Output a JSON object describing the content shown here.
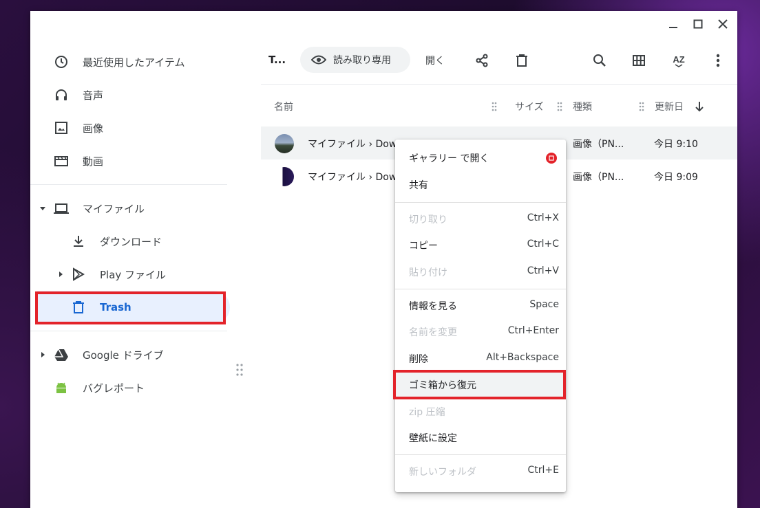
{
  "sidebar": {
    "recent": "最近使用したアイテム",
    "audio": "音声",
    "images": "画像",
    "videos": "動画",
    "my_files": "マイファイル",
    "downloads": "ダウンロード",
    "play_files": "Play ファイル",
    "trash": "Trash",
    "google_drive": "Google ドライブ",
    "bug_report": "バグレポート"
  },
  "toolbar": {
    "title": "T...",
    "readonly": "読み取り専用",
    "open": "開く",
    "sort_label": "AZ"
  },
  "list": {
    "columns": {
      "name": "名前",
      "size": "サイズ",
      "type": "種類",
      "modified": "更新日"
    },
    "rows": [
      {
        "name": "マイファイル › Dow",
        "type": "画像（PN...",
        "modified": "今日 9:10"
      },
      {
        "name": "マイファイル › Dow",
        "type": "画像（PN...",
        "modified": "今日 9:09"
      }
    ]
  },
  "menu": {
    "gallery": "ギャラリー で開く",
    "share": "共有",
    "cut": "切り取り",
    "cut_key": "Ctrl+X",
    "copy": "コピー",
    "copy_key": "Ctrl+C",
    "paste": "貼り付け",
    "paste_key": "Ctrl+V",
    "info": "情報を見る",
    "info_key": "Space",
    "rename": "名前を変更",
    "rename_key": "Ctrl+Enter",
    "delete": "削除",
    "delete_key": "Alt+Backspace",
    "restore": "ゴミ箱から復元",
    "zip": "zip 圧縮",
    "wallpaper": "壁紙に設定",
    "new_folder": "新しいフォルダ",
    "new_folder_key": "Ctrl+E"
  },
  "colors": {
    "accent": "#1967d2",
    "highlight_box": "#e3232a",
    "selected_bg": "#e8f0fe"
  }
}
